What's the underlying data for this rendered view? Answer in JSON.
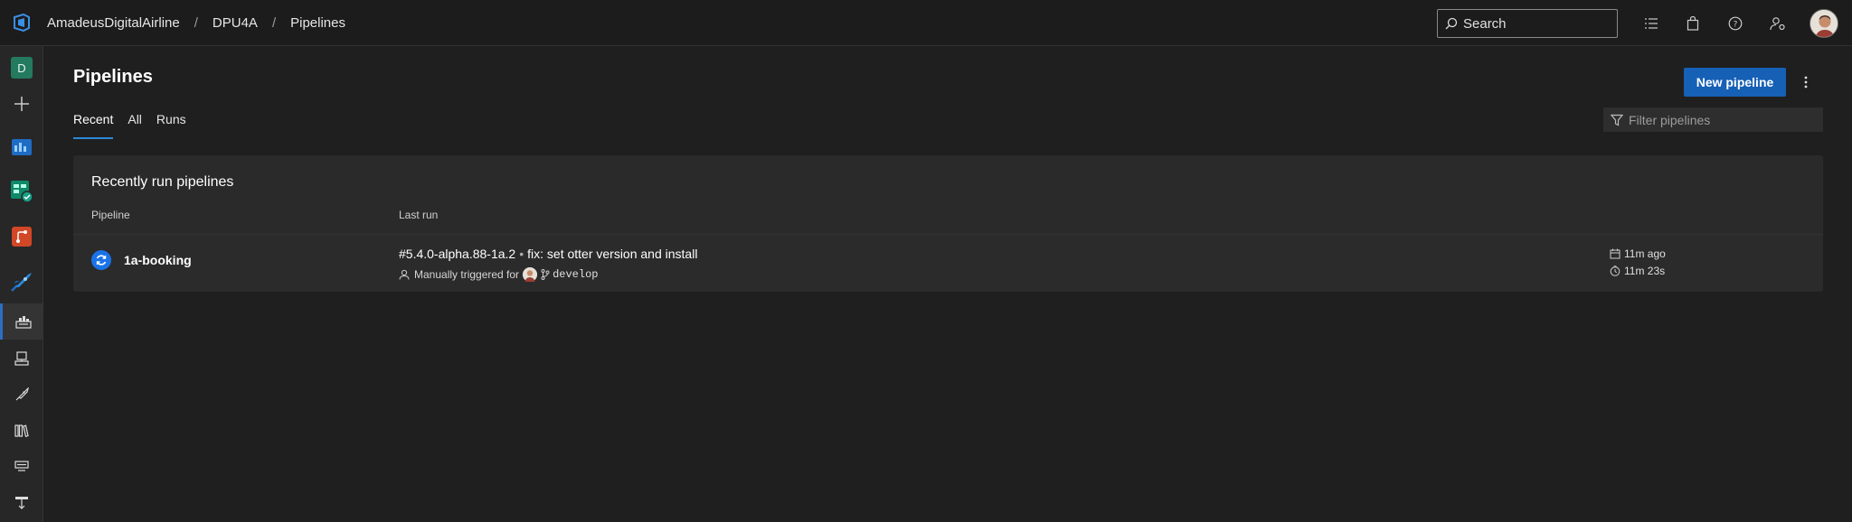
{
  "breadcrumb": {
    "org": "AmadeusDigitalAirline",
    "project": "DPU4A",
    "section": "Pipelines",
    "separator": "/"
  },
  "search": {
    "label": "Search"
  },
  "sidebar": {
    "project_initial": "D",
    "items": [
      "add-icon",
      "boards-icon",
      "boards-check-icon",
      "repos-icon",
      "pipelines-icon",
      "builds-icon",
      "environments-icon",
      "releases-icon",
      "library-icon",
      "task-groups-icon",
      "deployment-groups-icon"
    ]
  },
  "page": {
    "title": "Pipelines",
    "new_pipeline": "New pipeline",
    "tabs": [
      "Recent",
      "All",
      "Runs"
    ],
    "filter_placeholder": "Filter pipelines"
  },
  "recent": {
    "title": "Recently run pipelines",
    "col_pipeline": "Pipeline",
    "col_last_run": "Last run",
    "rows": [
      {
        "name": "1a-booking",
        "run_number": "#5.4.0-alpha.88-1a.2",
        "bullet": "•",
        "commit_message": "fix: set otter version and install",
        "trigger": "Manually triggered for",
        "branch": "develop",
        "ago": "11m ago",
        "duration": "11m 23s"
      }
    ]
  },
  "colors": {
    "background": "#1f1f1f",
    "accent": "#1660b6",
    "tab_underline": "#2b88d8",
    "project_badge": "#237a5f"
  }
}
